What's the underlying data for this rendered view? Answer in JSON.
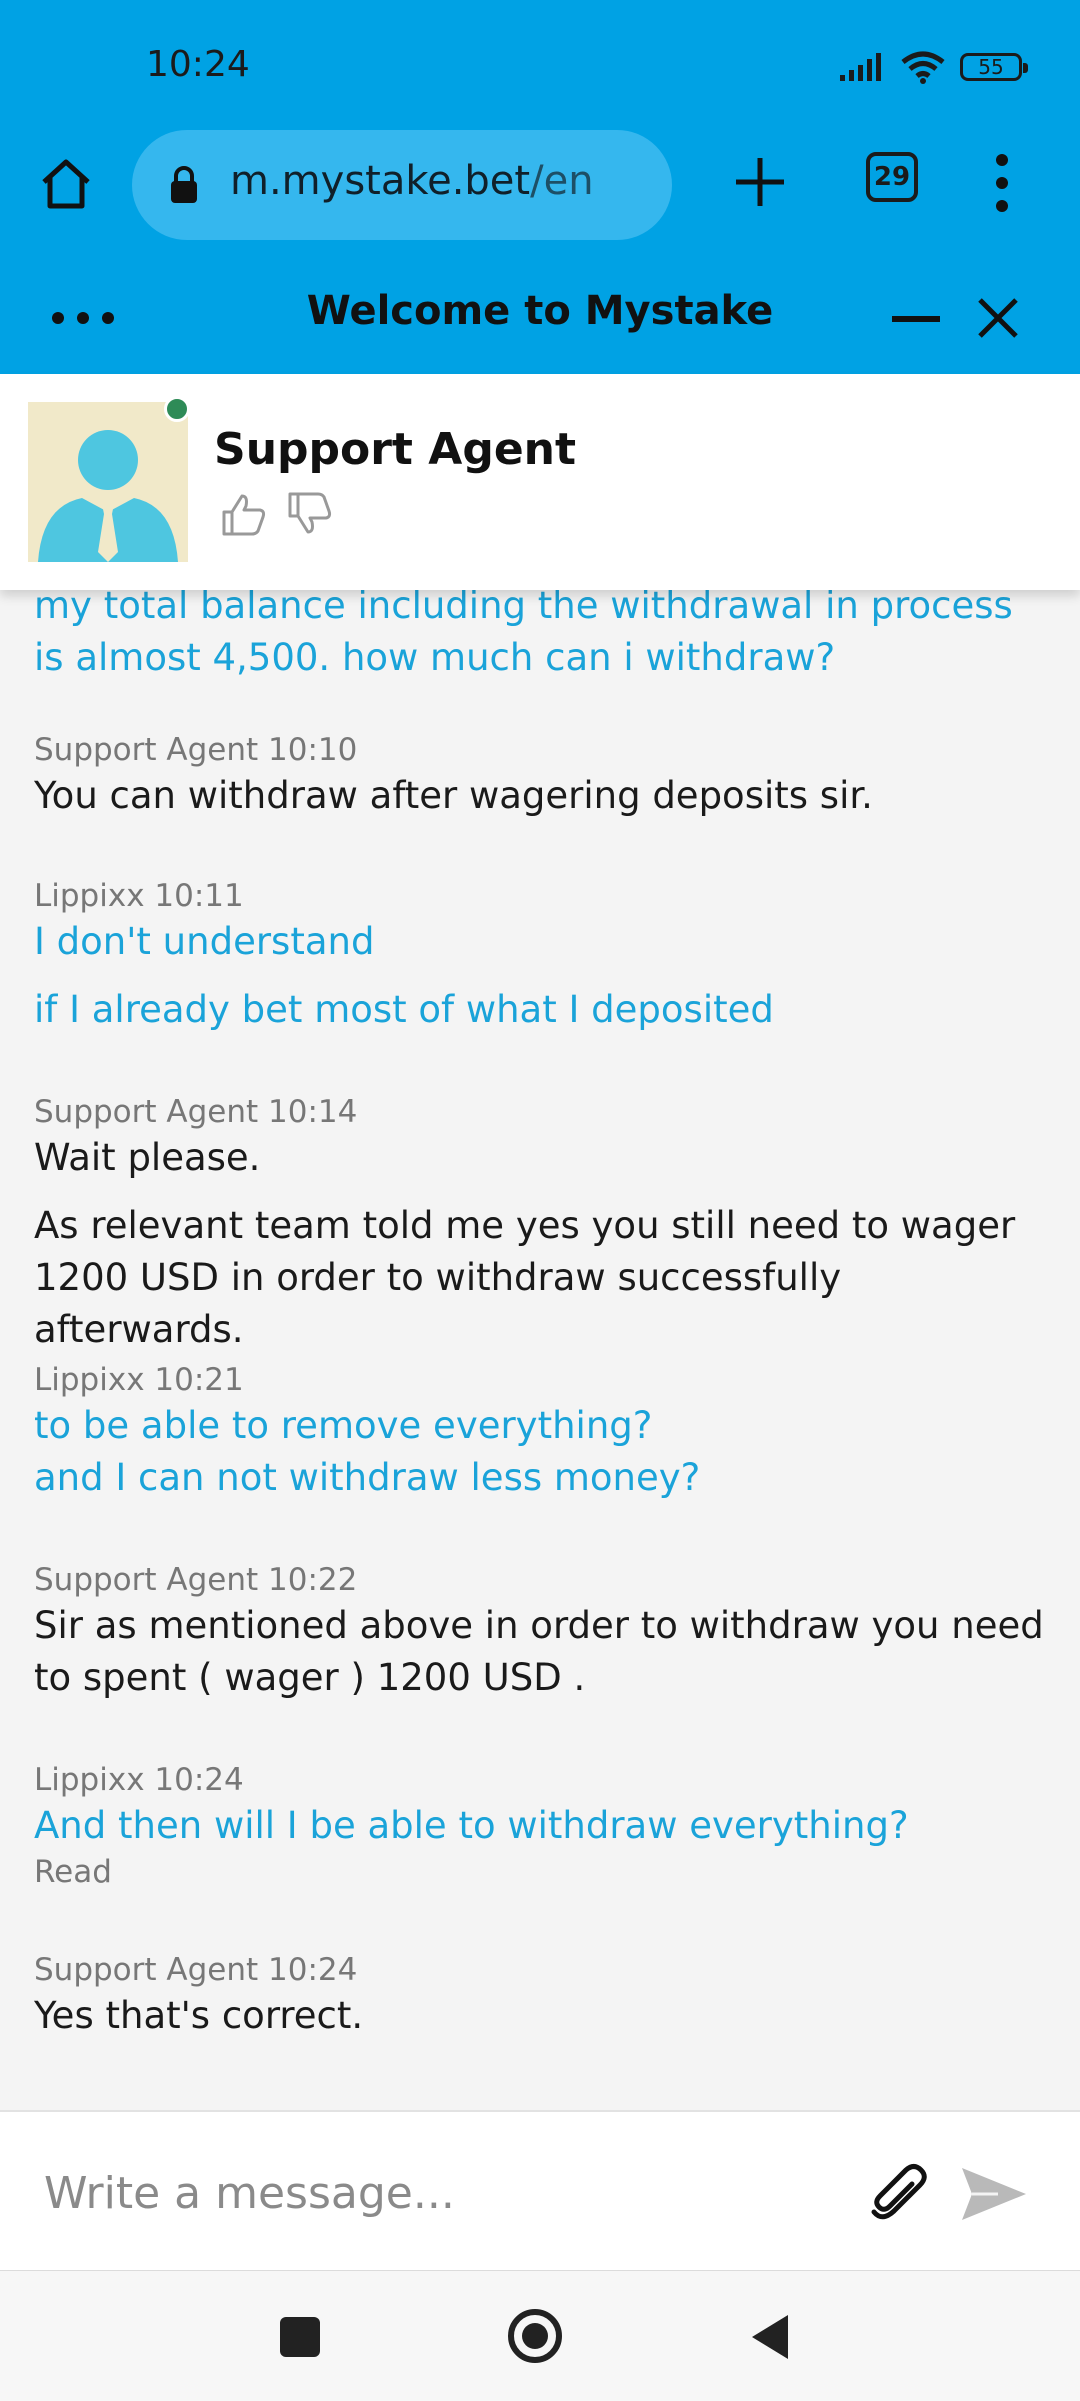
{
  "status_bar": {
    "time": "10:24",
    "battery": "55",
    "icons": [
      "signal-icon",
      "wifi-icon",
      "battery-icon"
    ]
  },
  "browser": {
    "url_domain": "m.mystake.bet",
    "url_path": "/en",
    "tab_count": "29",
    "icons": [
      "home-icon",
      "lock-icon",
      "plus-icon",
      "tabs-icon",
      "menu-icon"
    ]
  },
  "chat_header": {
    "title": "Welcome to Mystake",
    "icons": [
      "more-icon",
      "minimize-icon",
      "close-icon"
    ]
  },
  "agent": {
    "name": "Support Agent",
    "status": "online",
    "icons": [
      "avatar-icon",
      "thumbs-up-icon",
      "thumbs-down-icon"
    ]
  },
  "messages": [
    {
      "sender": "Lippixx",
      "time": "",
      "role": "user",
      "lines": [
        "my total balance including the withdrawal in process is almost 4,500. how much can i withdraw?"
      ]
    },
    {
      "sender": "Support Agent",
      "time": "10:10",
      "role": "agent",
      "lines": [
        "You can withdraw after wagering deposits sir."
      ]
    },
    {
      "sender": "Lippixx",
      "time": "10:11",
      "role": "user",
      "lines": [
        "I don't understand",
        "if I already bet most of what I deposited"
      ]
    },
    {
      "sender": "Support Agent",
      "time": "10:14",
      "role": "agent",
      "lines": [
        "Wait please.",
        "As relevant team told me yes you still need to wager 1200 USD in order to withdraw successfully afterwards."
      ]
    },
    {
      "sender": "Lippixx",
      "time": "10:21",
      "role": "user",
      "lines": [
        "to be able to remove everything?\nand I can not withdraw less money?"
      ]
    },
    {
      "sender": "Support Agent",
      "time": "10:22",
      "role": "agent",
      "lines": [
        "Sir as mentioned above in order to withdraw you need to spent ( wager ) 1200 USD ."
      ]
    },
    {
      "sender": "Lippixx",
      "time": "10:24",
      "role": "user",
      "lines": [
        "And then will I be able to withdraw everything?"
      ],
      "receipt": "Read"
    },
    {
      "sender": "Support Agent",
      "time": "10:24",
      "role": "agent",
      "lines": [
        "Yes that's correct."
      ]
    }
  ],
  "composer": {
    "placeholder": "Write a message...",
    "value": "",
    "icons": [
      "attach-icon",
      "send-icon"
    ]
  },
  "nav_bar": {
    "icons": [
      "recents-icon",
      "home-circle-icon",
      "back-icon"
    ]
  },
  "colors": {
    "brand": "#00a2e4",
    "user_text": "#1aa3d9",
    "agent_text": "#1a1a1a",
    "online": "#2e8b57"
  }
}
